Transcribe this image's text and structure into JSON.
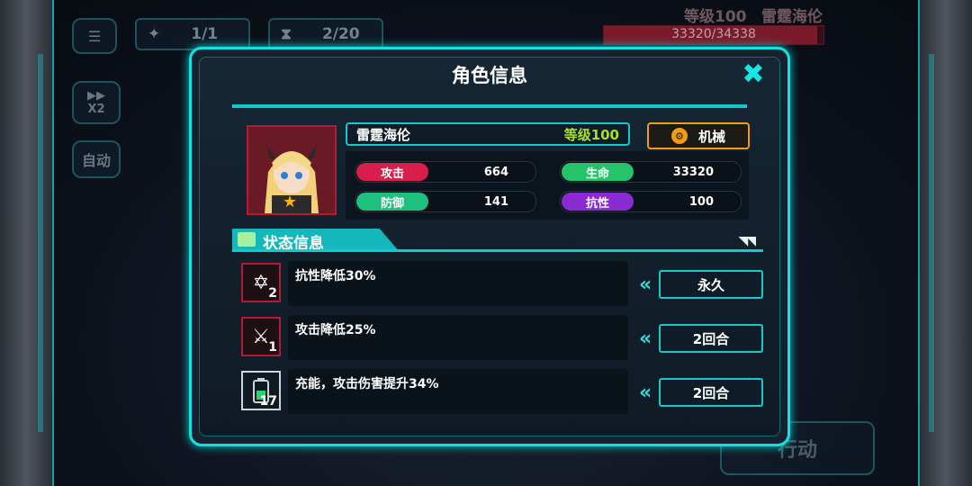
{
  "hud": {
    "menu_label": "",
    "unit_counter": "1/1",
    "turn_counter": "2/20",
    "speed_label": "X2",
    "auto_label": "自动",
    "action_label": "行动",
    "enemy_level": "等级100",
    "enemy_name": "雷霆海伦",
    "enemy_hp_text": "33320/34338",
    "enemy_hp_fraction": 0.97
  },
  "panel": {
    "title": "角色信息",
    "close_icon": "close-icon"
  },
  "character": {
    "name": "雷霆海伦",
    "level": "等级100",
    "type": "机械",
    "stats": {
      "attack_label": "攻击",
      "attack_value": "664",
      "hp_label": "生命",
      "hp_value": "33320",
      "defense_label": "防御",
      "defense_value": "141",
      "resist_label": "抗性",
      "resist_value": "100"
    }
  },
  "status": {
    "header": "状态信息",
    "effects": [
      {
        "icon": "resist-down-icon",
        "stacks": "2",
        "desc": "抗性降低30%",
        "duration": "永久"
      },
      {
        "icon": "attack-down-icon",
        "stacks": "1",
        "desc": "攻击降低25%",
        "duration": "2回合"
      },
      {
        "icon": "battery-charge-icon",
        "stacks": "17",
        "desc": "充能，攻击伤害提升34%",
        "duration": "2回合"
      }
    ]
  },
  "colors": {
    "accent": "#16e0e0",
    "attack": "#d81e4a",
    "hp": "#27c36a",
    "defense": "#1fbf7d",
    "resist": "#8a2bd1",
    "type_border": "#f39c12",
    "level": "#a7e02b"
  }
}
